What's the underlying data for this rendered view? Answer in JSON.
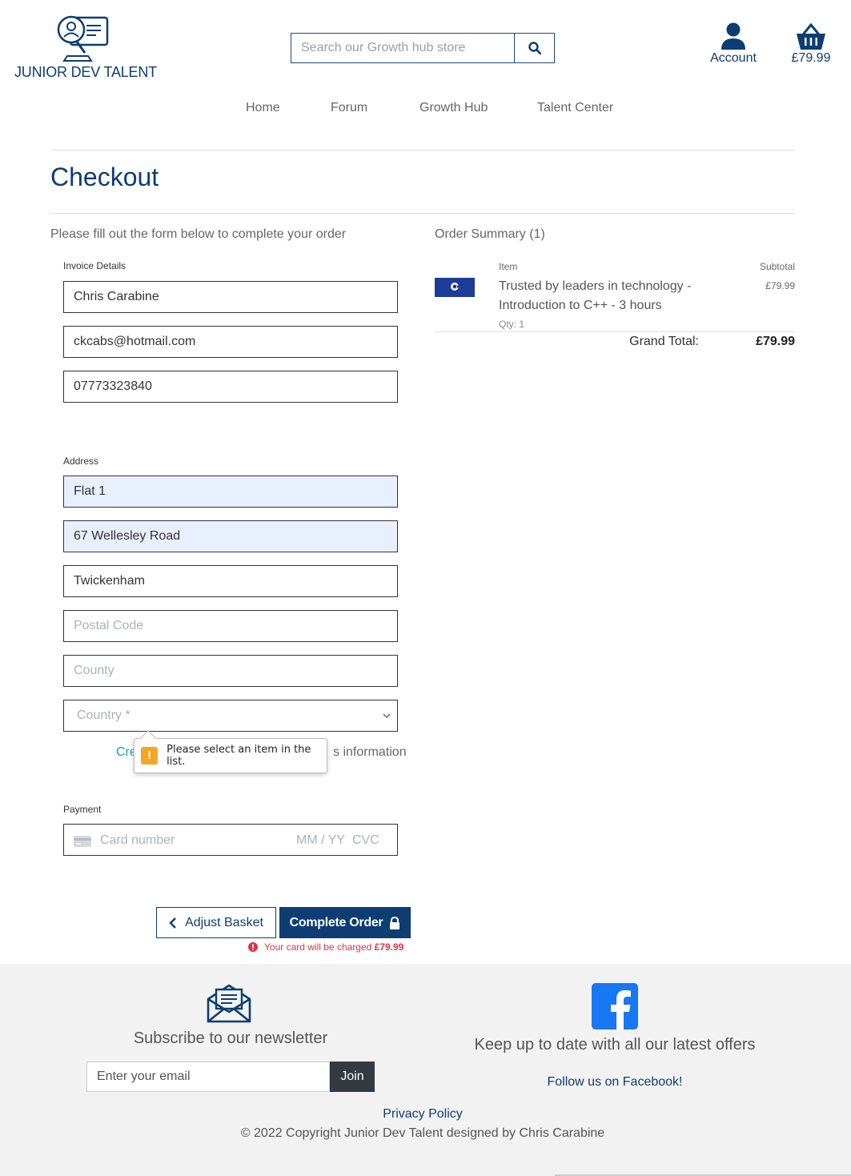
{
  "brand": {
    "name": "JUNIOR DEV TALENT",
    "primary_color": "#0d3d73",
    "accent_color": "#17a2b8",
    "error_color": "#dc3545"
  },
  "header": {
    "search_placeholder": "Search our Growth hub store",
    "search_icon": "search-icon",
    "account_label": "Account",
    "basket_total": "£79.99"
  },
  "nav": {
    "items": [
      "Home",
      "Forum",
      "Growth Hub",
      "Talent Center"
    ]
  },
  "page": {
    "title": "Checkout",
    "intro": "Please fill out the form below to complete your order"
  },
  "form": {
    "invoice": {
      "label": "Invoice Details",
      "full_name": "Chris Carabine",
      "email": "ckcabs@hotmail.com",
      "phone": "07773323840"
    },
    "address": {
      "label": "Address",
      "line1": "Flat 1",
      "line2": "67 Wellesley Road",
      "town": "Twickenham",
      "postcode_placeholder": "Postal Code",
      "county_placeholder": "County",
      "country_placeholder": "Country *"
    },
    "save_info": {
      "link_text": "Cre",
      "rest_text": "s information"
    },
    "validation_tooltip": "Please select an item in the list.",
    "payment": {
      "label": "Payment",
      "card_number_placeholder": "Card number",
      "expiry_placeholder": "MM / YY",
      "cvc_placeholder": "CVC"
    },
    "adjust_basket_label": "Adjust Basket",
    "complete_order_label": "Complete Order",
    "charge_note_prefix": "Your card will be charged",
    "charge_amount": "£79.99"
  },
  "summary": {
    "title": "Order Summary (1)",
    "col_item": "Item",
    "col_subtotal": "Subtotal",
    "items": [
      {
        "name": "Trusted by leaders in technology - Introduction to C++ - 3 hours",
        "qty": "Qty: 1",
        "subtotal": "£79.99"
      }
    ],
    "grand_total_label": "Grand Total:",
    "grand_total_value": "£79.99"
  },
  "footer": {
    "newsletter_title": "Subscribe to our newsletter",
    "email_placeholder": "Enter your email",
    "join_label": "Join",
    "offers_text": "Keep up to date with all our latest offers",
    "facebook_link": "Follow us on Facebook!",
    "privacy_link": "Privacy Policy",
    "copyright": "© 2022 Copyright Junior Dev Talent designed by Chris Carabine"
  }
}
